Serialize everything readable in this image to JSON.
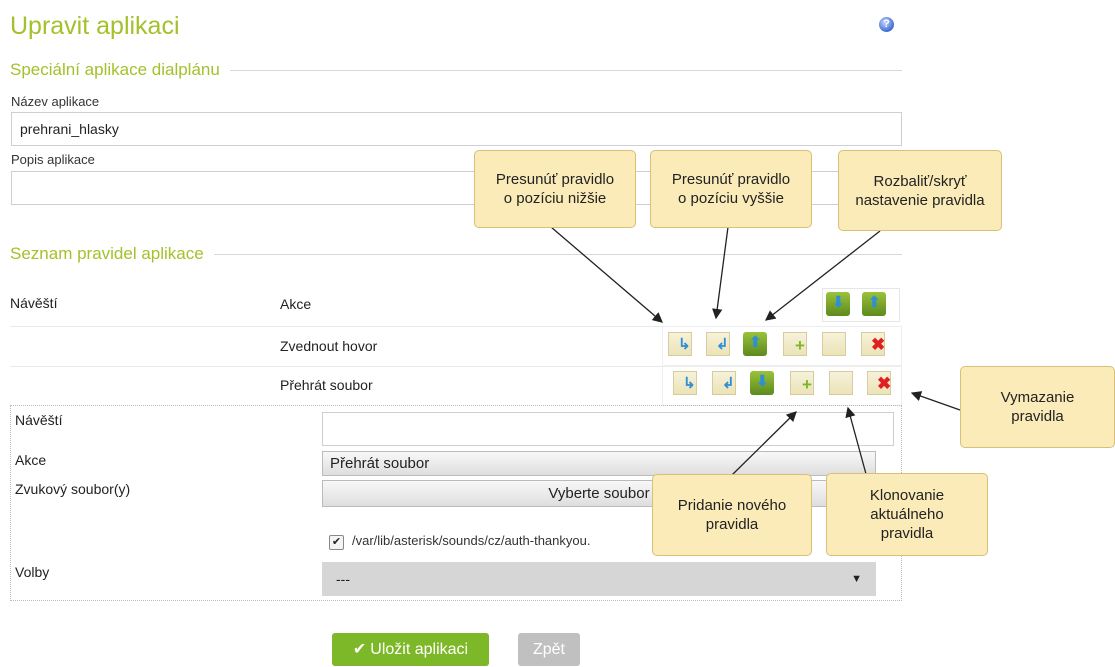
{
  "page": {
    "title": "Upravit aplikaci",
    "help_icon": "help-icon"
  },
  "section1": {
    "title": "Speciální aplikace dialplánu",
    "name_label": "Název aplikace",
    "name_value": "prehrani_hlasky",
    "desc_label": "Popis aplikace",
    "desc_value": ""
  },
  "section2": {
    "title": "Seznam pravidel aplikace",
    "header_label": "Návěští",
    "header_action": "Akce",
    "rules": [
      {
        "label": "",
        "action": "Zvednout hovor"
      },
      {
        "label": "",
        "action": "Přehrát soubor"
      }
    ]
  },
  "detail": {
    "label_label": "Návěští",
    "label_value": "",
    "action_label": "Akce",
    "action_value": "Přehrát soubor",
    "sound_label": "Zvukový soubor(y)",
    "sound_button": "Vyberte soubor",
    "file_path": "/var/lib/asterisk/sounds/cz/auth-thankyou.",
    "file_checked": true,
    "options_label": "Volby",
    "options_value": "---"
  },
  "buttons": {
    "save": "Uložit aplikaci",
    "back": "Zpět"
  },
  "callouts": {
    "move_down": "Presunúť pravidlo o pozíciu nižšie",
    "move_up": "Presunúť pravidlo o pozíciu vyššie",
    "toggle": "Rozbaliť/skryť nastavenie pravidla",
    "delete": "Vymazanie pravidla",
    "add": "Pridanie nového pravidla",
    "clone": "Klonovanie aktuálneho pravidla"
  },
  "colors": {
    "accent": "#a3c12b",
    "button_green": "#7db828",
    "callout_bg": "#fbebb8"
  }
}
